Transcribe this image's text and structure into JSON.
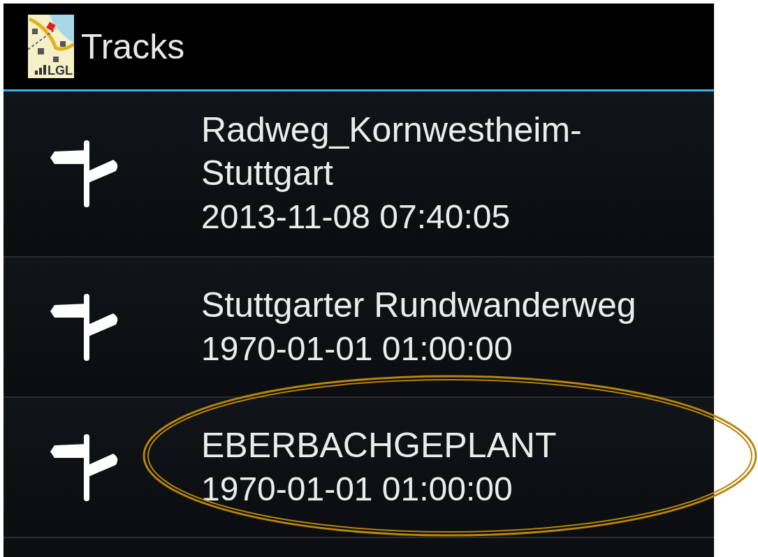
{
  "action_bar": {
    "logo_text": "LGL",
    "title": "Tracks"
  },
  "tracks": [
    {
      "name": "Radweg_Kornwestheim-Stuttgart",
      "date": "2013-11-08 07:40:05",
      "highlighted": false
    },
    {
      "name": "Stuttgarter Rundwanderweg",
      "date": "1970-01-01 01:00:00",
      "highlighted": false
    },
    {
      "name": "EBERBACHGEPLANT",
      "date": "1970-01-01 01:00:00",
      "highlighted": true
    }
  ]
}
